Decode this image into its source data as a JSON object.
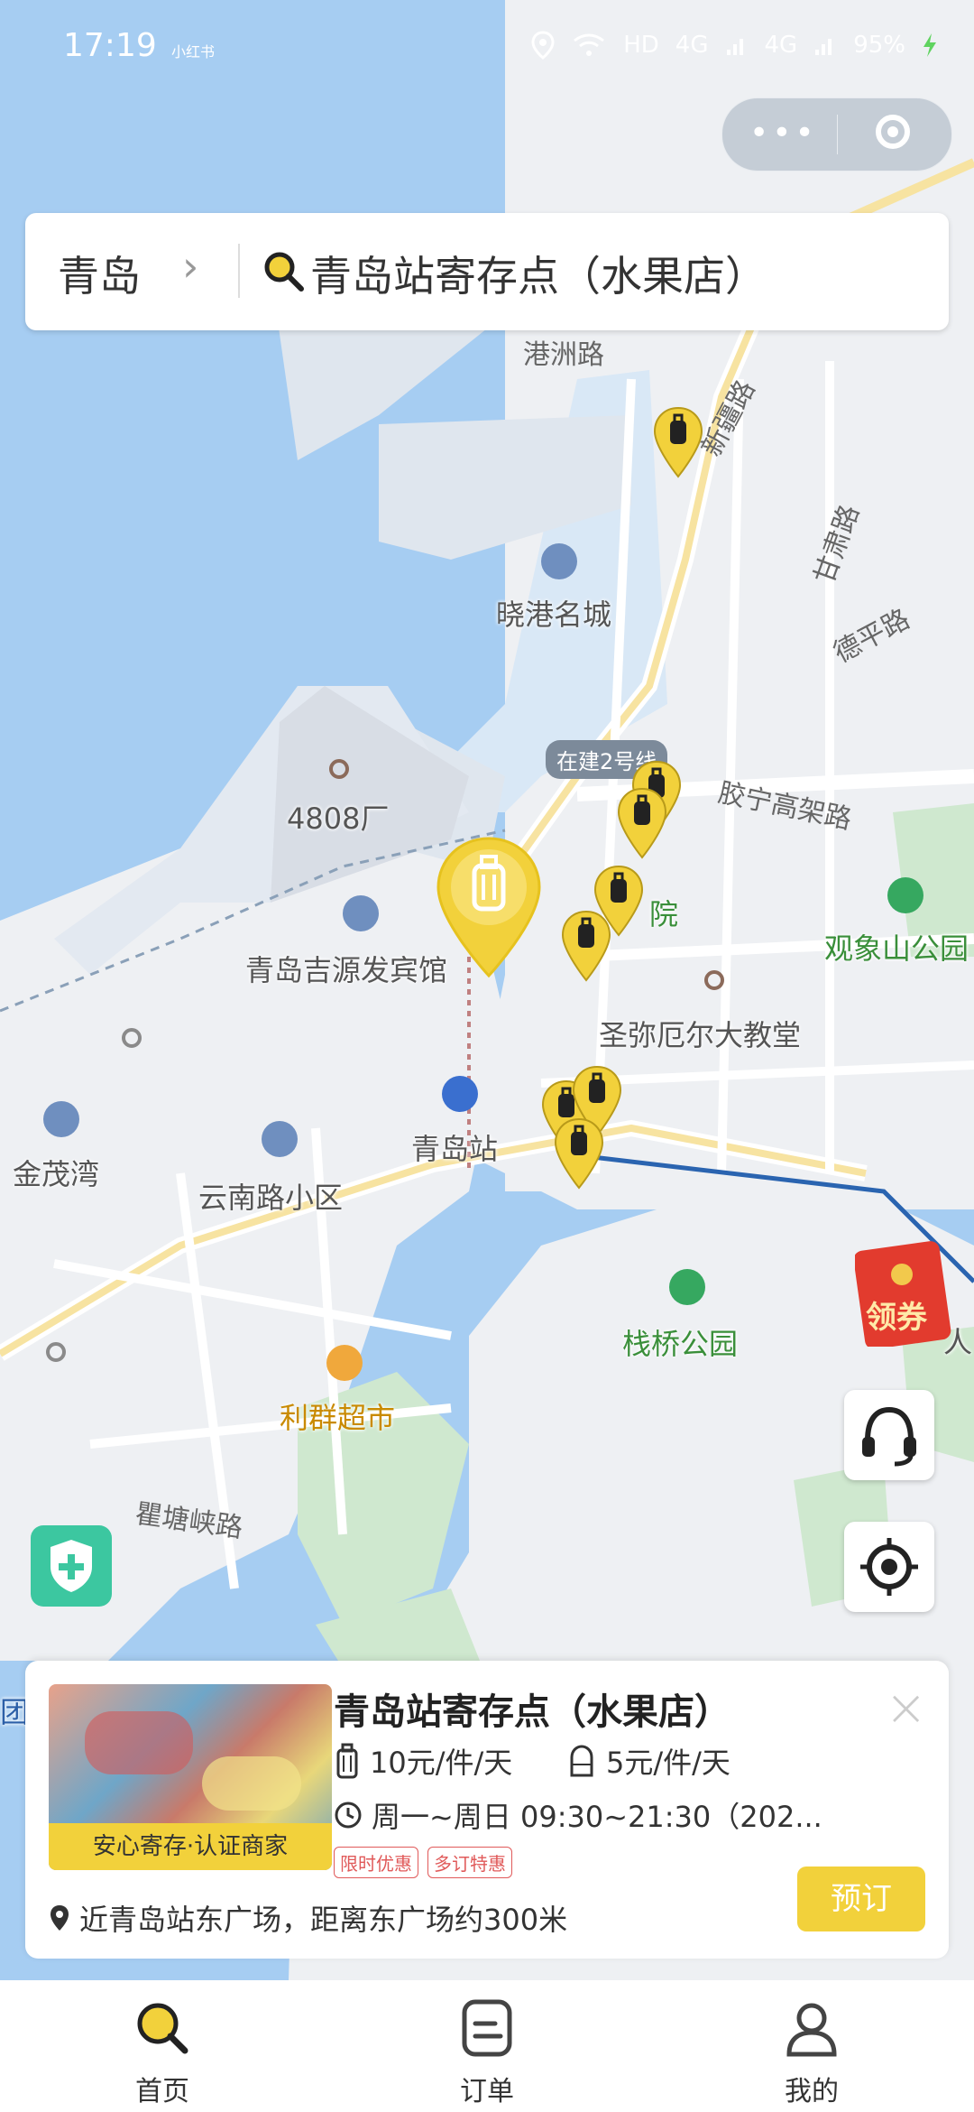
{
  "status_bar": {
    "time": "17:19",
    "carrier_note": "小红书",
    "network": "HD",
    "signal1": "4G",
    "signal2": "4G",
    "battery": "95%"
  },
  "capsule": {
    "more_icon": "more-dots-icon",
    "close_icon": "target-ring-icon"
  },
  "search": {
    "city": "青岛",
    "query": "青岛站寄存点（水果店）"
  },
  "map": {
    "labels": {
      "xiaogang": "晓港名城",
      "factory": "4808厂",
      "hotel": "青岛吉源发宾馆",
      "cathedral": "圣弥厄尔大教堂",
      "station": "青岛站",
      "jinmao": "金茂湾",
      "yunnan": "云南路小区",
      "park1": "栈桥公园",
      "supermarket": "利群超市",
      "park2": "观象山公园",
      "hospital_partial": "院",
      "edge_ren": "人",
      "edge_tuan": "团"
    },
    "roads": {
      "gangzhou": "港洲路",
      "xinjiang": "新疆路",
      "gansu": "甘肃路",
      "deping": "德平路",
      "jiaoning": "胶宁高架路",
      "qutang": "瞿塘峡路"
    },
    "metro_badge": "在建2号线",
    "coupon_label": "领券"
  },
  "store_card": {
    "title": "青岛站寄存点（水果店）",
    "thumb_tag": "安心寄存·认证商家",
    "price_large": "10元/件/天",
    "price_small": "5元/件/天",
    "hours": "周一~周日 09:30~21:30（202...",
    "badges": [
      "限时优惠",
      "多订特惠"
    ],
    "address": "近青岛站东广场，距离东广场约300米",
    "reserve_button": "预订"
  },
  "tabbar": {
    "home": "首页",
    "orders": "订单",
    "mine": "我的"
  },
  "colors": {
    "accent": "#f2d13b",
    "sea": "#a6cdf2",
    "land": "#eef0f3",
    "green": "#3cc7a0"
  }
}
